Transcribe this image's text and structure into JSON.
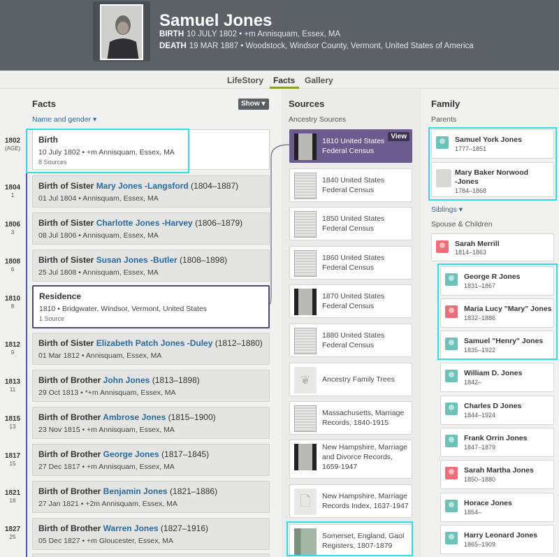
{
  "person": {
    "name": "Samuel Jones",
    "birth_label": "BIRTH",
    "birth_value": "10 JULY 1802 • +m Annisquam, Essex, MA",
    "death_label": "DEATH",
    "death_value": "19 MAR 1887 • Woodstock, Windsor County, Vermont, United States of America"
  },
  "tabs": [
    "LifeStory",
    "Facts",
    "Gallery"
  ],
  "facts": {
    "title": "Facts",
    "show_label": "Show ▾",
    "name_gender_label": "Name and gender ▾",
    "items": [
      {
        "year": "1802",
        "age": "(AGE)",
        "title": "Birth",
        "link": "",
        "years": "",
        "detail": "10 July 1802 • +m Annisquam, Essex, MA",
        "sources": "8 Sources"
      },
      {
        "year": "1804",
        "age": "1",
        "title": "Birth of Sister ",
        "link": "Mary Jones -Langsford",
        "years": " (1804–1887)",
        "detail": "01 Jul 1804 • Annisquam, Essex, MA",
        "sources": ""
      },
      {
        "year": "1806",
        "age": "3",
        "title": "Birth of Sister ",
        "link": "Charlotte Jones -Harvey",
        "years": " (1806–1879)",
        "detail": "08 Jul 1806 • Annisquam, Essex, MA",
        "sources": ""
      },
      {
        "year": "1808",
        "age": "6",
        "title": "Birth of Sister ",
        "link": "Susan Jones -Butler",
        "years": " (1808–1898)",
        "detail": "25 Jul 1808 • Annisquam, Essex, MA",
        "sources": ""
      },
      {
        "year": "1810",
        "age": "8",
        "title": "Residence",
        "link": "",
        "years": "",
        "detail": "1810 • Bridgwater, Windsor, Vermont, United States",
        "sources": "1 Source"
      },
      {
        "year": "1812",
        "age": "9",
        "title": "Birth of Sister ",
        "link": "Elizabeth Patch Jones -Duley",
        "years": " (1812–1880)",
        "detail": "01 Mar 1812 • Annisquam, Essex, MA",
        "sources": ""
      },
      {
        "year": "1813",
        "age": "11",
        "title": "Birth of Brother ",
        "link": "John Jones",
        "years": " (1813–1898)",
        "detail": "29 Oct 1813 • *+m Annisquam, Essex, MA",
        "sources": ""
      },
      {
        "year": "1815",
        "age": "13",
        "title": "Birth of Brother ",
        "link": "Ambrose Jones",
        "years": " (1815–1900)",
        "detail": "23 Nov 1815 • +m Annisquam, Essex, MA",
        "sources": ""
      },
      {
        "year": "1817",
        "age": "15",
        "title": "Birth of Brother ",
        "link": "George Jones",
        "years": " (1817–1845)",
        "detail": "27 Dec 1817 • +m Annisquam, Essex, MA",
        "sources": ""
      },
      {
        "year": "1821",
        "age": "18",
        "title": "Birth of Brother ",
        "link": "Benjamin Jones",
        "years": " (1821–1886)",
        "detail": "27 Jan 1821 • +2m Annisquam, Essex, MA",
        "sources": ""
      },
      {
        "year": "1827",
        "age": "25",
        "title": "Birth of Brother ",
        "link": "Warren Jones",
        "years": " (1827–1916)",
        "detail": "05 Dec 1827 • +m Gloucester, Essex, MA",
        "sources": ""
      }
    ]
  },
  "sources": {
    "title": "Sources",
    "subtitle": "Ancestry Sources",
    "view_label": "View",
    "items": [
      {
        "label": "1810 United States Federal Census",
        "thumb": "film"
      },
      {
        "label": "1840 United States Federal Census",
        "thumb": "doc"
      },
      {
        "label": "1850 United States Federal Census",
        "thumb": "doc"
      },
      {
        "label": "1860 United States Federal Census",
        "thumb": "doc"
      },
      {
        "label": "1870 United States Federal Census",
        "thumb": "film"
      },
      {
        "label": "1880 United States Federal Census",
        "thumb": "doc"
      },
      {
        "label": "Ancestry Family Trees",
        "thumb": "tree"
      },
      {
        "label": "Massachusetts, Marriage Records, 1840-1915",
        "thumb": "doc"
      },
      {
        "label": "New Hampshire, Marriage and Divorce Records, 1659-1947",
        "thumb": "film"
      },
      {
        "label": "New Hampshire, Marriage Records Index, 1637-1947",
        "thumb": "page"
      },
      {
        "label": "Somerset, England, Gaol Registers, 1807-1879",
        "thumb": "green"
      }
    ]
  },
  "family": {
    "title": "Family",
    "parents_label": "Parents",
    "siblings_label": "Siblings ▾",
    "spouse_label": "Spouse & Children",
    "parents": [
      {
        "name": "Samuel York Jones",
        "dates": "1777–1851",
        "gender": "m"
      },
      {
        "name": "Mary Baker Norwood\n-Jones",
        "dates": "1784–1868",
        "gender": "img"
      }
    ],
    "spouse": {
      "name": "Sarah Merrill",
      "dates": "1814–1863",
      "gender": "f"
    },
    "children": [
      {
        "name": "George R Jones",
        "dates": "1831–1867",
        "gender": "m"
      },
      {
        "name": "Maria Lucy \"Mary\" Jones",
        "dates": "1832–1886",
        "gender": "f"
      },
      {
        "name": "Samuel \"Henry\" Jones",
        "dates": "1835–1922",
        "gender": "m"
      },
      {
        "name": "William D. Jones",
        "dates": "1842–",
        "gender": "m"
      },
      {
        "name": "Charles D Jones",
        "dates": "1844–1924",
        "gender": "m"
      },
      {
        "name": "Frank Orrin Jones",
        "dates": "1847–1879",
        "gender": "m"
      },
      {
        "name": "Sarah Martha Jones",
        "dates": "1850–1880",
        "gender": "f"
      },
      {
        "name": "Horace Jones",
        "dates": "1854–",
        "gender": "m"
      },
      {
        "name": "Harry Leonard Jones",
        "dates": "1865–1909",
        "gender": "m"
      }
    ]
  }
}
